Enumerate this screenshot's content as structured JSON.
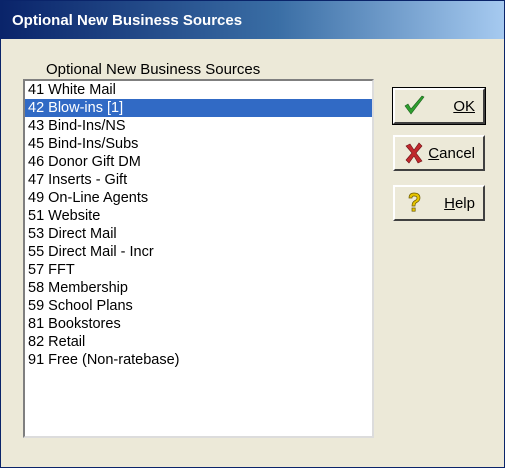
{
  "window": {
    "title": "Optional New Business Sources"
  },
  "list": {
    "caption": "Optional New Business Sources",
    "items": [
      "41 White Mail",
      "42 Blow-ins [1]",
      "43 Bind-Ins/NS",
      "45 Bind-Ins/Subs",
      "46 Donor Gift DM",
      "47 Inserts - Gift",
      "49 On-Line Agents",
      "51 Website",
      "53 Direct Mail",
      "55 Direct Mail - Incr",
      "57 FFT",
      "58 Membership",
      "59 School Plans",
      "81 Bookstores",
      "82 Retail",
      "91 Free (Non-ratebase)"
    ],
    "selected_index": 1
  },
  "buttons": {
    "ok": {
      "label": "OK",
      "icon": "checkmark-icon",
      "color": "#2e9e2e"
    },
    "cancel": {
      "label": "Cancel",
      "icon": "red-x-icon",
      "color": "#c0282d"
    },
    "help": {
      "label": "Help",
      "icon": "question-mark-icon",
      "color": "#d4b300"
    }
  },
  "colors": {
    "selection": "#316ac5",
    "titlebar_start": "#0a246a",
    "titlebar_end": "#a6caf0",
    "dialog_bg": "#ece9d8"
  }
}
